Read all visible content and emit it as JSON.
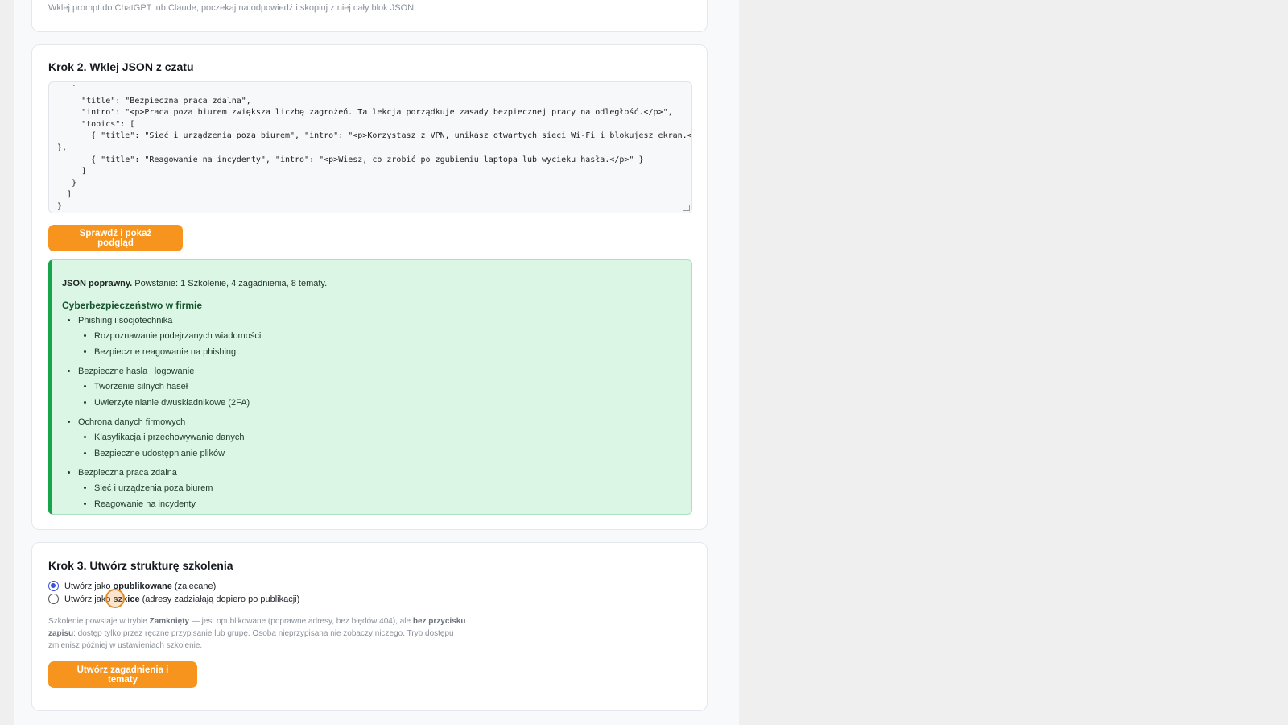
{
  "step1": {
    "hint": "Wklej prompt do ChatGPT lub Claude, poczekaj na odpowiedź i skopiuj z niej cały blok JSON."
  },
  "step2": {
    "title": "Krok 2. Wklej JSON z czatu",
    "json_lines": [
      "   `",
      "     \"title\": \"Bezpieczna praca zdalna\",",
      "     \"intro\": \"<p>Praca poza biurem zwiększa liczbę zagrożeń. Ta lekcja porządkuje zasady bezpiecznej pracy na odległość.</p>\",",
      "     \"topics\": [",
      "       { \"title\": \"Sieć i urządzenia poza biurem\", \"intro\": \"<p>Korzystasz z VPN, unikasz otwartych sieci Wi-Fi i blokujesz ekran.</p>\"",
      "},",
      "       { \"title\": \"Reagowanie na incydenty\", \"intro\": \"<p>Wiesz, co zrobić po zgubieniu laptopa lub wycieku hasła.</p>\" }",
      "     ]",
      "   }",
      "  ]",
      "}"
    ],
    "check_button": "Sprawdź i pokaż podgląd",
    "result": {
      "status_bold": "JSON poprawny.",
      "status_rest": " Powstanie: 1 Szkolenie, 4 zagadnienia, 8 tematy.",
      "course_title": "Cyberbezpieczeństwo w firmie",
      "sections": [
        {
          "name": "Phishing i socjotechnika",
          "topics": [
            "Rozpoznawanie podejrzanych wiadomości",
            "Bezpieczne reagowanie na phishing"
          ]
        },
        {
          "name": "Bezpieczne hasła i logowanie",
          "topics": [
            "Tworzenie silnych haseł",
            "Uwierzytelnianie dwuskładnikowe (2FA)"
          ]
        },
        {
          "name": "Ochrona danych firmowych",
          "topics": [
            "Klasyfikacja i przechowywanie danych",
            "Bezpieczne udostępnianie plików"
          ]
        },
        {
          "name": "Bezpieczna praca zdalna",
          "topics": [
            "Sieć i urządzenia poza biurem",
            "Reagowanie na incydenty"
          ]
        }
      ]
    }
  },
  "step3": {
    "title": "Krok 3. Utwórz strukturę szkolenia",
    "option_published": {
      "prefix": "Utwórz jako ",
      "bold": "opublikowane",
      "suffix": " (zalecane)",
      "selected": true
    },
    "option_draft": {
      "prefix": "Utwórz jako ",
      "bold": "szkice",
      "suffix": " (adresy zadziałają dopiero po publikacji)",
      "selected": false
    },
    "note": {
      "p1": "Szkolenie powstaje w trybie ",
      "b1": "Zamknięty",
      "p2": " — jest opublikowane (poprawne adresy, bez błędów 404), ale ",
      "b2": "bez przycisku zapisu",
      "p3": ": dostęp tylko przez ręczne przypisanie lub grupę. Osoba nieprzypisana nie zobaczy niczego. Tryb dostępu zmienisz później w ustawieniach szkolenie."
    },
    "create_button": "Utwórz zagadnienia i tematy"
  },
  "colors": {
    "accent": "#f7941d",
    "success_bg": "#dcf6e6",
    "success_border": "#17a54b",
    "radio": "#3b4fd9"
  }
}
